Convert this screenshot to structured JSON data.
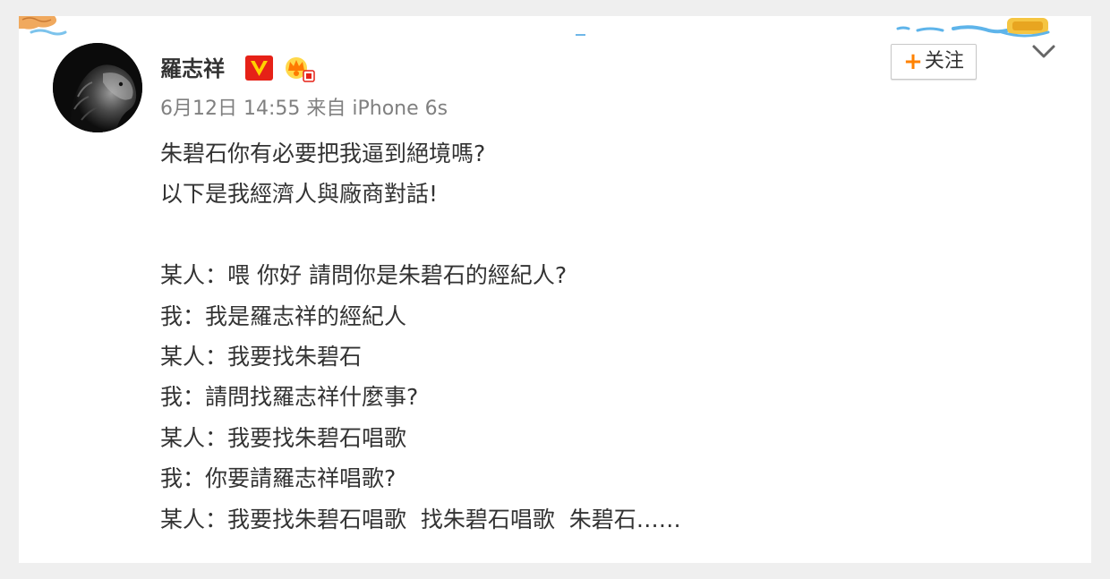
{
  "post": {
    "author_name": "羅志祥",
    "verified_badge": "V",
    "member_badge_icon": "crown-icon",
    "meta": "6月12日 14:55 来自 iPhone 6s",
    "follow_button": {
      "plus": "+",
      "label": "关注"
    },
    "dropdown_icon": "chevron-down-icon",
    "content_lines": [
      "朱碧石你有必要把我逼到絕境嗎?",
      "以下是我經濟人與廠商對話!",
      "",
      "某人：喂 你好 請問你是朱碧石的經紀人?",
      "我：我是羅志祥的經紀人",
      "某人：我要找朱碧石",
      "我：請問找羅志祥什麼事?",
      "某人：我要找朱碧石唱歌",
      "我：你要請羅志祥唱歌?",
      "某人：我要找朱碧石唱歌  找朱碧石唱歌  朱碧石……"
    ]
  },
  "colors": {
    "page_background": "#efefef",
    "card_background": "#ffffff",
    "text_primary": "#333333",
    "text_meta": "#808080",
    "accent_orange": "#ff8200",
    "verified_red": "#e62117",
    "verified_yellow": "#ffd200"
  }
}
